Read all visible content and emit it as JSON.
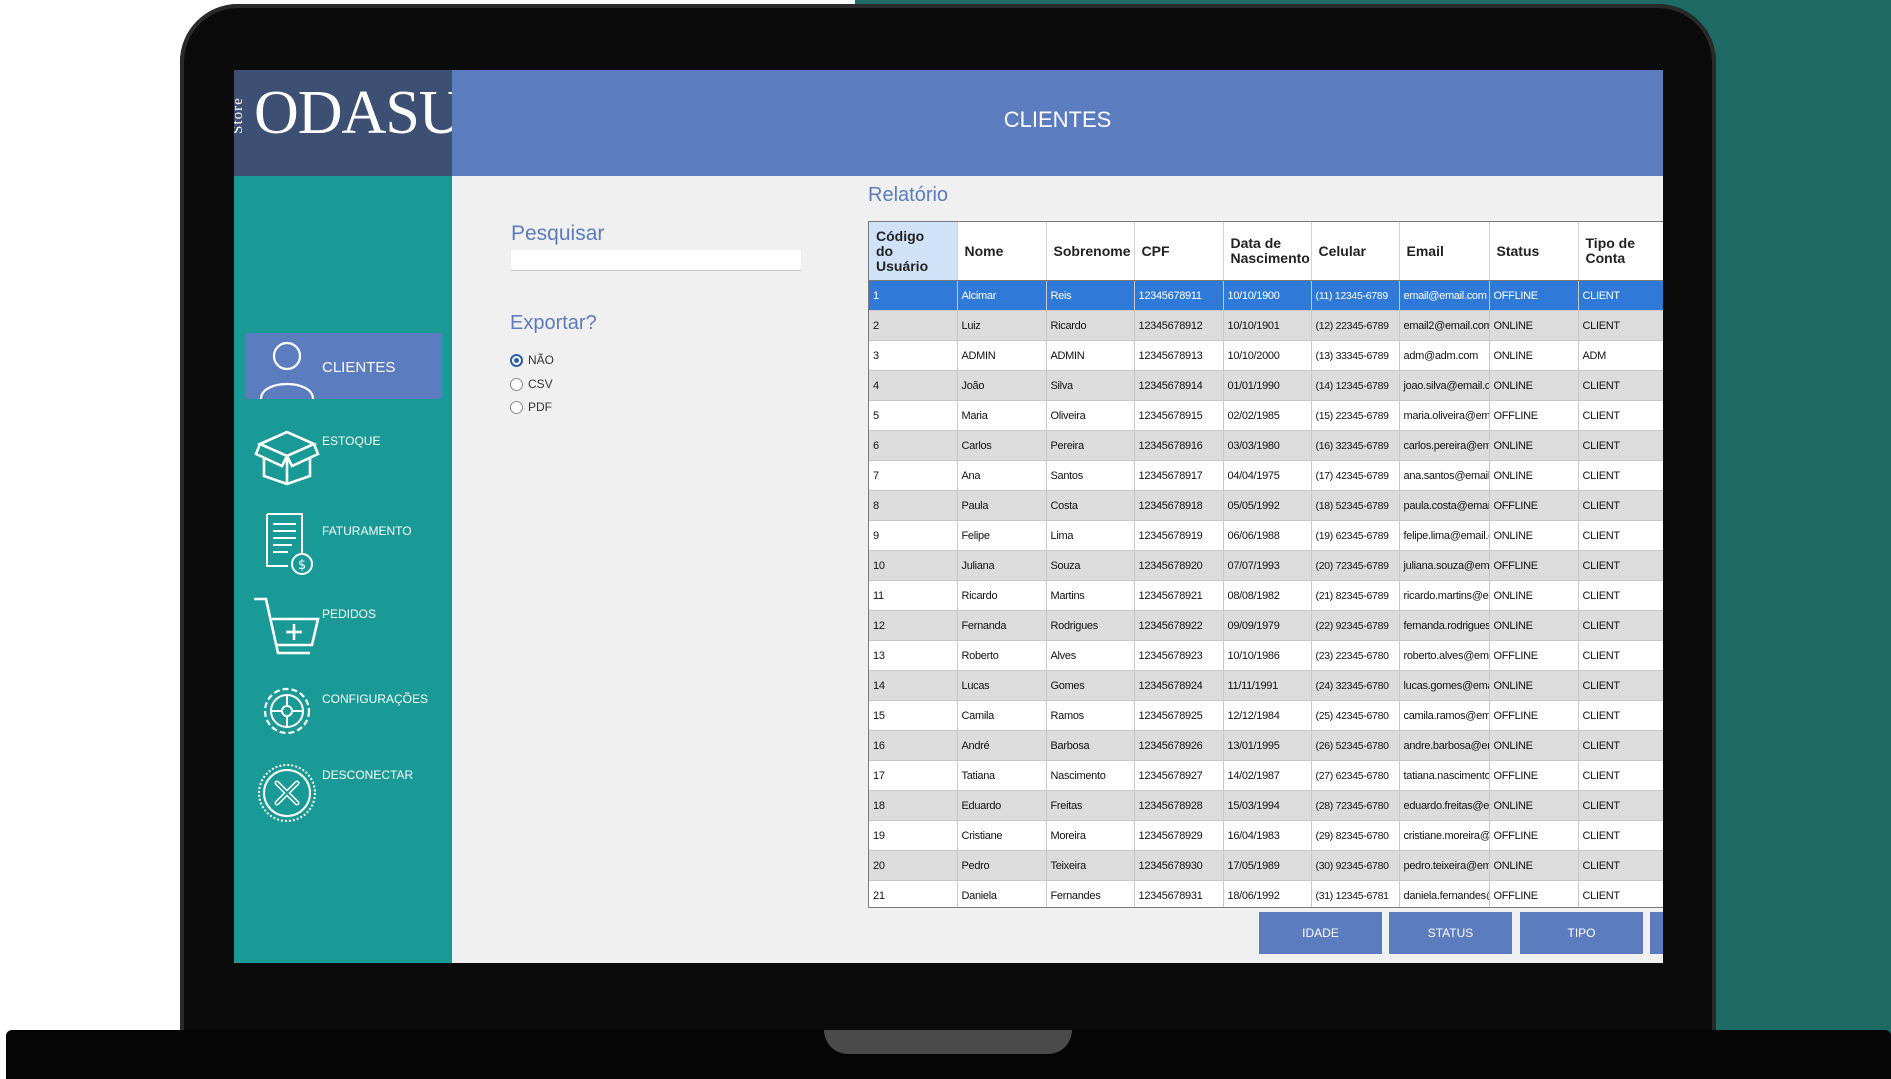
{
  "logo": {
    "brand": "ODASU",
    "sub": "Store"
  },
  "header": {
    "title": "CLIENTES"
  },
  "sidebar": {
    "items": [
      {
        "label": "CLIENTES",
        "icon": "user-icon",
        "active": true
      },
      {
        "label": "ESTOQUE",
        "icon": "box-icon"
      },
      {
        "label": "FATURAMENTO",
        "icon": "invoice-icon"
      },
      {
        "label": "PEDIDOS",
        "icon": "cart-icon"
      },
      {
        "label": "CONFIGURAÇÕES",
        "icon": "gear-icon"
      },
      {
        "label": "DESCONECTAR",
        "icon": "disconnect-icon"
      }
    ]
  },
  "search": {
    "label": "Pesquisar",
    "value": ""
  },
  "export": {
    "label": "Exportar?",
    "options": [
      "NÃO",
      "CSV",
      "PDF"
    ],
    "selected": "NÃO"
  },
  "report": {
    "title": "Relatório",
    "columns": [
      "Código do Usuário",
      "Nome",
      "Sobrenome",
      "CPF",
      "Data de Nascimento",
      "Celular",
      "Email",
      "Status",
      "Tipo de Conta"
    ],
    "rows": [
      [
        "1",
        "Alcimar",
        "Reis",
        "12345678911",
        "10/10/1900",
        "(11) 12345-6789",
        "email@email.com",
        "OFFLINE",
        "CLIENT"
      ],
      [
        "2",
        "Luiz",
        "Ricardo",
        "12345678912",
        "10/10/1901",
        "(12) 22345-6789",
        "email2@email.com",
        "ONLINE",
        "CLIENT"
      ],
      [
        "3",
        "ADMIN",
        "ADMIN",
        "12345678913",
        "10/10/2000",
        "(13) 33345-6789",
        "adm@adm.com",
        "ONLINE",
        "ADM"
      ],
      [
        "4",
        "João",
        "Silva",
        "12345678914",
        "01/01/1990",
        "(14) 12345-6789",
        "joao.silva@email.com",
        "ONLINE",
        "CLIENT"
      ],
      [
        "5",
        "Maria",
        "Oliveira",
        "12345678915",
        "02/02/1985",
        "(15) 22345-6789",
        "maria.oliveira@email.com",
        "OFFLINE",
        "CLIENT"
      ],
      [
        "6",
        "Carlos",
        "Pereira",
        "12345678916",
        "03/03/1980",
        "(16) 32345-6789",
        "carlos.pereira@email.com",
        "ONLINE",
        "CLIENT"
      ],
      [
        "7",
        "Ana",
        "Santos",
        "12345678917",
        "04/04/1975",
        "(17) 42345-6789",
        "ana.santos@email.com",
        "ONLINE",
        "CLIENT"
      ],
      [
        "8",
        "Paula",
        "Costa",
        "12345678918",
        "05/05/1992",
        "(18) 52345-6789",
        "paula.costa@email.com",
        "OFFLINE",
        "CLIENT"
      ],
      [
        "9",
        "Felipe",
        "Lima",
        "12345678919",
        "06/06/1988",
        "(19) 62345-6789",
        "felipe.lima@email.com",
        "ONLINE",
        "CLIENT"
      ],
      [
        "10",
        "Juliana",
        "Souza",
        "12345678920",
        "07/07/1993",
        "(20) 72345-6789",
        "juliana.souza@email.com",
        "OFFLINE",
        "CLIENT"
      ],
      [
        "11",
        "Ricardo",
        "Martins",
        "12345678921",
        "08/08/1982",
        "(21) 82345-6789",
        "ricardo.martins@email.com",
        "ONLINE",
        "CLIENT"
      ],
      [
        "12",
        "Fernanda",
        "Rodrigues",
        "12345678922",
        "09/09/1979",
        "(22) 92345-6789",
        "fernanda.rodrigues@email.com",
        "ONLINE",
        "CLIENT"
      ],
      [
        "13",
        "Roberto",
        "Alves",
        "12345678923",
        "10/10/1986",
        "(23) 22345-6780",
        "roberto.alves@email.com",
        "OFFLINE",
        "CLIENT"
      ],
      [
        "14",
        "Lucas",
        "Gomes",
        "12345678924",
        "11/11/1991",
        "(24) 32345-6780",
        "lucas.gomes@email.com",
        "ONLINE",
        "CLIENT"
      ],
      [
        "15",
        "Camila",
        "Ramos",
        "12345678925",
        "12/12/1984",
        "(25) 42345-6780",
        "camila.ramos@email.com",
        "OFFLINE",
        "CLIENT"
      ],
      [
        "16",
        "André",
        "Barbosa",
        "12345678926",
        "13/01/1995",
        "(26) 52345-6780",
        "andre.barbosa@email.com",
        "ONLINE",
        "CLIENT"
      ],
      [
        "17",
        "Tatiana",
        "Nascimento",
        "12345678927",
        "14/02/1987",
        "(27) 62345-6780",
        "tatiana.nascimento@email.com",
        "OFFLINE",
        "CLIENT"
      ],
      [
        "18",
        "Eduardo",
        "Freitas",
        "12345678928",
        "15/03/1994",
        "(28) 72345-6780",
        "eduardo.freitas@email.com",
        "ONLINE",
        "CLIENT"
      ],
      [
        "19",
        "Cristiane",
        "Moreira",
        "12345678929",
        "16/04/1983",
        "(29) 82345-6780",
        "cristiane.moreira@email.com",
        "OFFLINE",
        "CLIENT"
      ],
      [
        "20",
        "Pedro",
        "Teixeira",
        "12345678930",
        "17/05/1989",
        "(30) 92345-6780",
        "pedro.teixeira@email.com",
        "ONLINE",
        "CLIENT"
      ],
      [
        "21",
        "Daniela",
        "Fernandes",
        "12345678931",
        "18/06/1992",
        "(31) 12345-6781",
        "daniela.fernandes@email.com",
        "OFFLINE",
        "CLIENT"
      ]
    ],
    "selected_row": 0
  },
  "filters": [
    "IDADE",
    "STATUS",
    "TIPO"
  ],
  "colors": {
    "accent": "#5c7cc0",
    "sidebar": "#1a9a96",
    "selection": "#2f7ad8",
    "backdrop": "#1e6b66"
  }
}
